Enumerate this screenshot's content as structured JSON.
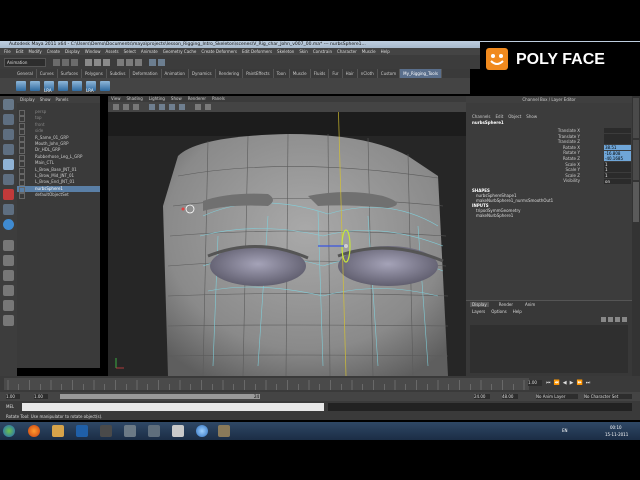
{
  "window": {
    "title": "Autodesk Maya 2011 x64 - C:\\Users\\Demo\\Documents\\maya\\projects\\lesson_Rigging_Intro_Skeleton\\scenes\\V_Rig_char_John_v007_00.ma* --- nurbsSphere1...",
    "minimize": "_",
    "maximize": "□",
    "close": "X"
  },
  "menubar": [
    "File",
    "Edit",
    "Modify",
    "Create",
    "Display",
    "Window",
    "Assets",
    "Select",
    "Animate",
    "Geometry Cache",
    "Create Deformers",
    "Edit Deformers",
    "Skeleton",
    "Skin",
    "Constrain",
    "Character",
    "Muscle",
    "Help"
  ],
  "statusline": {
    "mode": "Animation"
  },
  "shelf_tabs": [
    "General",
    "Curves",
    "Surfaces",
    "Polygons",
    "Subdivs",
    "Deformation",
    "Animation",
    "Dynamics",
    "Rendering",
    "PaintEffects",
    "Toon",
    "Muscle",
    "Fluids",
    "Fur",
    "Hair",
    "nCloth",
    "Custom",
    "My_Rigging_Tools"
  ],
  "shelf_active_index": 17,
  "shelf_icon_labels": [
    "",
    "",
    "LRA",
    "",
    "",
    "LRA",
    ""
  ],
  "logo": {
    "text": "POLY FACE"
  },
  "outliner": {
    "menu": [
      "Display",
      "Show",
      "Panels"
    ],
    "items": [
      {
        "label": "persp",
        "dim": true
      },
      {
        "label": "top",
        "dim": true
      },
      {
        "label": "front",
        "dim": true
      },
      {
        "label": "side",
        "dim": true
      },
      {
        "label": "R_Same_01_GRP",
        "dim": false
      },
      {
        "label": "Mouth_John_GRP",
        "dim": false
      },
      {
        "label": "Dr_HDL_GRP",
        "dim": false
      },
      {
        "label": "Rubberhose_Leg_L_GRP",
        "dim": false
      },
      {
        "label": "Main_CTL",
        "dim": false
      },
      {
        "label": "L_Brow_Base_JNT_01",
        "dim": false
      },
      {
        "label": "L_Brow_Mid_JNT_01",
        "dim": false
      },
      {
        "label": "L_Brow_End_JNT_01",
        "dim": false
      },
      {
        "label": "nurbsSphere1",
        "dim": false,
        "selected": true
      },
      {
        "label": "defaultObjectSet",
        "dim": false
      }
    ]
  },
  "viewport": {
    "menu": [
      "View",
      "Shading",
      "Lighting",
      "Show",
      "Renderer",
      "Panels"
    ]
  },
  "channelbox": {
    "header": "Channel Box / Layer Editor",
    "menu": [
      "Channels",
      "Edit",
      "Object",
      "Show"
    ],
    "object": "nurbsSphere1",
    "attrs": [
      {
        "label": "Translate X",
        "value": "",
        "hl": false
      },
      {
        "label": "Translate Y",
        "value": "",
        "hl": false
      },
      {
        "label": "Translate Z",
        "value": "",
        "hl": false
      },
      {
        "label": "Rotate X",
        "value": "38.51",
        "hl": true
      },
      {
        "label": "Rotate Y",
        "value": "-16.808",
        "hl": true
      },
      {
        "label": "Rotate Z",
        "value": "-40.1685",
        "hl": true
      },
      {
        "label": "Scale X",
        "value": "1",
        "hl": false
      },
      {
        "label": "Scale Y",
        "value": "1",
        "hl": false
      },
      {
        "label": "Scale Z",
        "value": "1",
        "hl": false
      },
      {
        "label": "Visibility",
        "value": "on",
        "hl": false
      }
    ],
    "shapes_title": "SHAPES",
    "shapes": [
      "nurbsSphereShape1",
      "makeNurbSphere1_nurmsSmoothOut1"
    ],
    "inputs_title": "INPUTS",
    "inputs": [
      "tripodSymmGeometry",
      "makeNurbSphere1"
    ]
  },
  "layer_editor": {
    "tabs": [
      "Display",
      "Render",
      "Anim"
    ],
    "menu": [
      "Layers",
      "Options",
      "Help"
    ]
  },
  "timeline": {
    "start": "1.00",
    "end": "24.00",
    "end2": "48.00",
    "current": "1.00",
    "range_mark": "24",
    "anim_layer": "No Anim Layer",
    "character": "No Character Set"
  },
  "cmdline": {
    "label": "MEL"
  },
  "helpline": {
    "text": "Rotate Tool: Use manipulator to rotate object(s)."
  },
  "taskbar": {
    "lang": "EN",
    "time": "00:10",
    "date": "15-11-2011"
  }
}
